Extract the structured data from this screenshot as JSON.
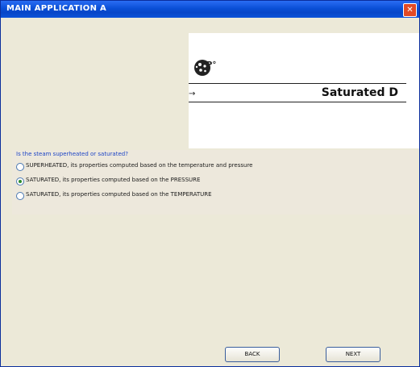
{
  "window": {
    "title": "MAIN APPLICATION A",
    "close_label": "✕"
  },
  "diagram": {
    "symbol_label": "P°",
    "arrow": "→",
    "state_label": "Saturated D",
    "icon_name": "steam-cloud-icon"
  },
  "question": {
    "prompt": "Is the steam superheated or saturated?",
    "options": [
      {
        "label": "SUPERHEATED, its properties computed based on the temperature and pressure",
        "selected": false
      },
      {
        "label": "SATURATED, its properties computed based on the PRESSURE",
        "selected": true
      },
      {
        "label": "SATURATED, its properties computed based on the TEMPERATURE",
        "selected": false
      }
    ]
  },
  "buttons": {
    "back_label": "BACK",
    "next_label": "NEXT"
  },
  "colors": {
    "titlebar": "#0a4fd6",
    "window_bg": "#ece9d8",
    "question_text": "#1e45c6",
    "close_button": "#e24a25"
  }
}
